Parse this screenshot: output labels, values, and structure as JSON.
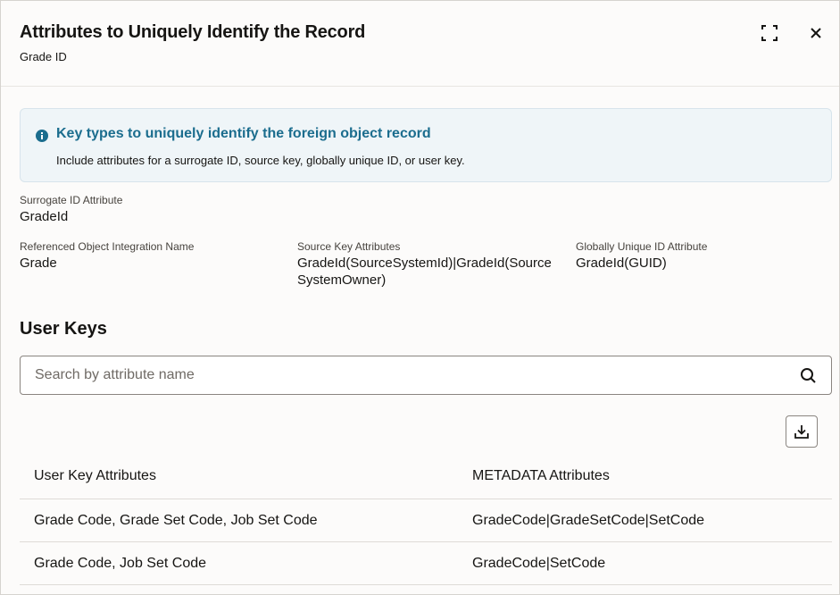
{
  "dialog": {
    "title": "Attributes to Uniquely Identify the Record",
    "subtitle": "Grade ID"
  },
  "banner": {
    "title": "Key types to uniquely identify the foreign object record",
    "text": "Include attributes for a surrogate ID, source key, globally unique ID, or user key."
  },
  "fields": {
    "surrogate_id": {
      "label": "Surrogate ID Attribute",
      "value": "GradeId"
    },
    "referenced_object": {
      "label": "Referenced Object Integration Name",
      "value": "Grade"
    },
    "source_key": {
      "label": "Source Key Attributes",
      "value": "GradeId(SourceSystemId)|GradeId(SourceSystemOwner)"
    },
    "guid": {
      "label": "Globally Unique ID Attribute",
      "value": "GradeId(GUID)"
    }
  },
  "user_keys": {
    "title": "User Keys",
    "search_placeholder": "Search by attribute name",
    "columns": [
      "User Key Attributes",
      "METADATA Attributes"
    ],
    "rows": [
      [
        "Grade Code, Grade Set Code, Job Set Code",
        "GradeCode|GradeSetCode|SetCode"
      ],
      [
        "Grade Code, Job Set Code",
        "GradeCode|SetCode"
      ]
    ]
  },
  "colors": {
    "accent": "#1b6d8e",
    "banner_bg": "#eff5f8"
  },
  "icons": [
    "maximize-icon",
    "close-icon",
    "info-icon",
    "search-icon",
    "download-icon"
  ]
}
